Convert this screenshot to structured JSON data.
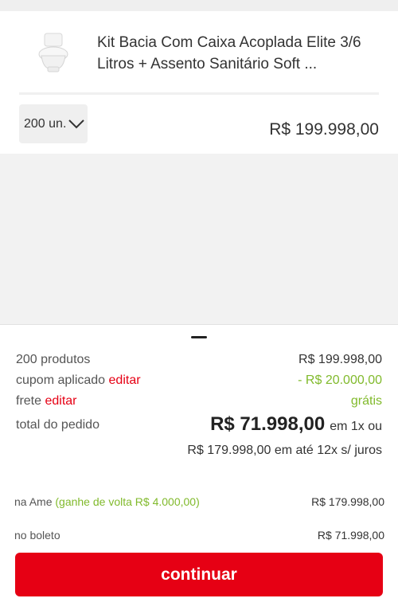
{
  "product": {
    "title": "Kit Bacia Com Caixa Acoplada Elite 3/6 Litros + Assento Sanitário Soft ...",
    "quantity": "200 un.",
    "price": "R$ 199.998,00",
    "image_icon": "toilet-image"
  },
  "summary": {
    "products_label": "200 produtos",
    "products_value": "R$ 199.998,00",
    "coupon_label": "cupom aplicado",
    "coupon_edit": "editar",
    "coupon_value": "- R$ 20.000,00",
    "shipping_label": "frete",
    "shipping_edit": "editar",
    "shipping_value": "grátis",
    "total_label": "total do pedido",
    "total_value": "R$ 71.998,00",
    "total_suffix": "em 1x ou",
    "installments": "R$ 179.998,00 em até 12x s/ juros"
  },
  "payment": {
    "ame_label": "na Ame",
    "ame_cashback": "(ganhe de volta R$ 4.000,00)",
    "ame_value": "R$ 179.998,00",
    "boleto_label": "no boleto",
    "boleto_value": "R$ 71.998,00"
  },
  "cta": {
    "label": "continuar"
  },
  "colors": {
    "accent": "#e60014",
    "green": "#81ba2c"
  }
}
